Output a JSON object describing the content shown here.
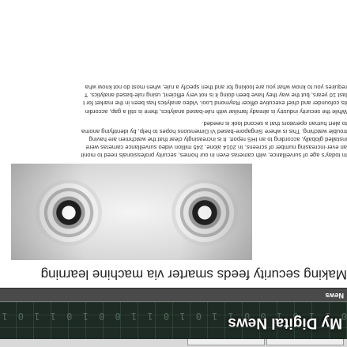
{
  "site": {
    "title": "My Digital News"
  },
  "nav": {
    "items": [
      "News"
    ]
  },
  "article": {
    "headline": "Making security feeds smarter via machine learning",
    "hero_icons": [
      "eye-icon",
      "eye-icon"
    ],
    "paragraphs": [
      [
        "In today’s age of surveillance, with cameras even in our homes, security professionals need to monit",
        "an ever-increasing number of screens. In 2014 alone, 245 million video surveillance cameras were",
        "installed globally, according to an IHS report. It is increasingly clear that the watchmen are having",
        "trouble watching. This is where Singapore-based Vi Dimensions hopes to help, by identifying anoma",
        "to alert human operators that a second look is needed."
      ],
      [
        "While the security industry is already familiar with rule-based analytics, there is still a gap, accordin",
        "its cofounder and chief executive officer Raymond Looi. Video analytics has been in the market for t",
        "last 10 years, but the way they have been doing it is not very efficient, using rule-based analytics. T",
        "requires you to know what you are looking for and then specify a rule, when most do not know wha"
      ]
    ]
  },
  "colors": {
    "banner_bg": "#1e2a24",
    "nav_bg": "#4a4a4a",
    "headline": "#222222",
    "body_text": "#333333"
  }
}
